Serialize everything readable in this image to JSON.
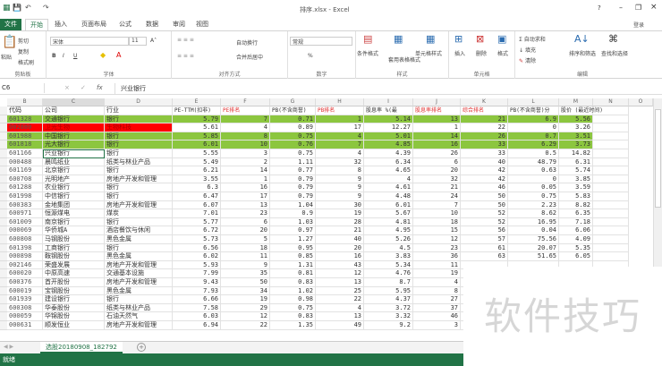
{
  "window": {
    "title": "排序.xlsx - Excel",
    "help": "?",
    "minimize": "–",
    "restore": "❐",
    "close": "×",
    "login": "登录"
  },
  "quick_access": {
    "save": "💾",
    "undo": "↶",
    "redo": "↷"
  },
  "tabs": [
    "文件",
    "开始",
    "插入",
    "页面布局",
    "公式",
    "数据",
    "审阅",
    "视图"
  ],
  "active_tab": "开始",
  "ribbon": {
    "clipboard": {
      "label": "剪贴板",
      "paste": "粘贴",
      "cut": "剪切",
      "copy": "复制",
      "format_painter": "格式刷"
    },
    "font": {
      "label": "字体",
      "name": "宋体",
      "size": "11",
      "bold": "B",
      "italic": "I",
      "underline": "U",
      "grow": "A˄",
      "shrink": "A˅"
    },
    "alignment": {
      "label": "对齐方式",
      "wrap": "自动换行",
      "merge": "合并后居中"
    },
    "number": {
      "label": "数字",
      "format": "常规",
      "percent": "%"
    },
    "styles": {
      "label": "样式",
      "conditional": "条件格式",
      "table": "套用表格格式",
      "cell": "单元格样式"
    },
    "cells": {
      "label": "单元格",
      "insert": "插入",
      "delete": "删除",
      "format": "格式"
    },
    "editing": {
      "label": "编辑",
      "autosum": "自动求和",
      "fill": "填充",
      "clear": "清除",
      "sort": "排序和筛选",
      "find": "查找和选择"
    }
  },
  "formula_bar": {
    "name_box": "C6",
    "cancel": "×",
    "enter": "✓",
    "fx": "fx",
    "value": "兴业银行"
  },
  "columns": [
    "B",
    "C",
    "D",
    "E",
    "F",
    "G",
    "H",
    "I",
    "J",
    "K",
    "L",
    "M",
    "N",
    "O"
  ],
  "headers": [
    "代码",
    "公司",
    "行业",
    "PE-TTM(扣非)",
    "PE排名",
    "PB(不含商誉)",
    "PB排名",
    "股息率 %(最",
    "股息率排名",
    "综合排名",
    "PB(不含商誉)分",
    "股价 (最近时间)"
  ],
  "red_headers": [
    4,
    6,
    8,
    9
  ],
  "colors": {
    "green": "#8cc63f",
    "red": "#ff0000",
    "excel": "#217346",
    "header_red": "#e03030"
  },
  "rows": [
    {
      "hl": "green",
      "c": [
        "601328",
        "交通银行",
        "银行",
        "5.79",
        "7",
        "0.71",
        "1",
        "5.14",
        "13",
        "21",
        "6.9",
        "5.56"
      ]
    },
    {
      "hl": "red",
      "c": [
        "002880",
        "卫光生物",
        "生物科技",
        "5.61",
        "4",
        "0.89",
        "17",
        "12.27",
        "1",
        "22",
        "0",
        "3.26"
      ]
    },
    {
      "hl": "green",
      "c": [
        "601988",
        "中国银行",
        "银行",
        "5.85",
        "8",
        "0.75",
        "4",
        "5.01",
        "14",
        "26",
        "0.7",
        "3.51"
      ]
    },
    {
      "hl": "green",
      "c": [
        "601818",
        "光大银行",
        "银行",
        "6.01",
        "10",
        "0.76",
        "7",
        "4.85",
        "16",
        "33",
        "6.29",
        "3.73"
      ]
    },
    {
      "c": [
        "601166",
        "兴业银行",
        "银行",
        "5.55",
        "3",
        "0.75",
        "4",
        "4.39",
        "26",
        "33",
        "0.5",
        "14.82"
      ]
    },
    {
      "c": [
        "000488",
        "晨鸣纸业",
        "纸类与林业产品",
        "5.49",
        "2",
        "1.11",
        "32",
        "6.34",
        "6",
        "40",
        "48.79",
        "6.31"
      ]
    },
    {
      "c": [
        "601169",
        "北京银行",
        "银行",
        "6.21",
        "14",
        "0.77",
        "8",
        "4.65",
        "20",
        "42",
        "0.63",
        "5.74"
      ]
    },
    {
      "c": [
        "600708",
        "光明地产",
        "房地产开发和管理",
        "3.55",
        "1",
        "0.79",
        "9",
        "4",
        "32",
        "42",
        "0",
        "3.85"
      ]
    },
    {
      "c": [
        "601288",
        "农业银行",
        "银行",
        "6.3",
        "16",
        "0.79",
        "9",
        "4.61",
        "21",
        "46",
        "0.05",
        "3.59"
      ]
    },
    {
      "c": [
        "601998",
        "中信银行",
        "银行",
        "6.47",
        "17",
        "0.79",
        "9",
        "4.48",
        "24",
        "50",
        "0.75",
        "5.83"
      ]
    },
    {
      "c": [
        "600383",
        "金地集团",
        "房地产开发和管理",
        "6.07",
        "13",
        "1.04",
        "30",
        "6.01",
        "7",
        "50",
        "2.23",
        "8.82"
      ]
    },
    {
      "c": [
        "600971",
        "恒源煤电",
        "煤炭",
        "7.01",
        "23",
        "0.9",
        "19",
        "5.67",
        "10",
        "52",
        "8.62",
        "6.35"
      ]
    },
    {
      "c": [
        "601009",
        "南京银行",
        "银行",
        "5.77",
        "6",
        "1.03",
        "28",
        "4.81",
        "18",
        "52",
        "16.95",
        "7.18"
      ]
    },
    {
      "c": [
        "000069",
        "华侨城A",
        "酒店餐饮与休闲",
        "6.72",
        "20",
        "0.97",
        "21",
        "4.95",
        "15",
        "56",
        "0.04",
        "6.06"
      ]
    },
    {
      "c": [
        "600808",
        "马钢股份",
        "黑色金属",
        "5.73",
        "5",
        "1.27",
        "40",
        "5.26",
        "12",
        "57",
        "75.56",
        "4.09"
      ]
    },
    {
      "c": [
        "601398",
        "工商银行",
        "银行",
        "6.56",
        "18",
        "0.95",
        "20",
        "4.5",
        "23",
        "61",
        "20.07",
        "5.35"
      ]
    },
    {
      "c": [
        "000898",
        "鞍钢股份",
        "黑色金属",
        "6.02",
        "11",
        "0.85",
        "16",
        "3.83",
        "36",
        "63",
        "51.65",
        "6.05"
      ]
    },
    {
      "c": [
        "002146",
        "荣盛发展",
        "房地产开发和管理",
        "5.93",
        "9",
        "1.31",
        "43",
        "5.34",
        "11"
      ]
    },
    {
      "c": [
        "600020",
        "中原高速",
        "交通基本设施",
        "7.99",
        "35",
        "0.81",
        "12",
        "4.76",
        "19"
      ]
    },
    {
      "c": [
        "600376",
        "首开股份",
        "房地产开发和管理",
        "9.43",
        "50",
        "0.83",
        "13",
        "8.7",
        "4"
      ]
    },
    {
      "c": [
        "600019",
        "宝钢股份",
        "黑色金属",
        "7.93",
        "34",
        "1.02",
        "25",
        "5.95",
        "8"
      ]
    },
    {
      "c": [
        "601939",
        "建设银行",
        "银行",
        "6.66",
        "19",
        "0.98",
        "22",
        "4.37",
        "27"
      ]
    },
    {
      "c": [
        "600308",
        "华泰股份",
        "纸类与林业产品",
        "7.58",
        "29",
        "0.75",
        "4",
        "3.72",
        "37"
      ]
    },
    {
      "c": [
        "000059",
        "华锦股份",
        "石油天然气",
        "6.03",
        "12",
        "0.83",
        "13",
        "3.32",
        "46"
      ]
    },
    {
      "c": [
        "000631",
        "顺发恒业",
        "房地产开发和管理",
        "6.94",
        "22",
        "1.35",
        "49",
        "9.2",
        "3"
      ]
    }
  ],
  "selected_row_index": 4,
  "sheet_tab": "选股20180908_182792",
  "add_sheet": "+",
  "status": "就绪",
  "watermark": "软件技巧"
}
